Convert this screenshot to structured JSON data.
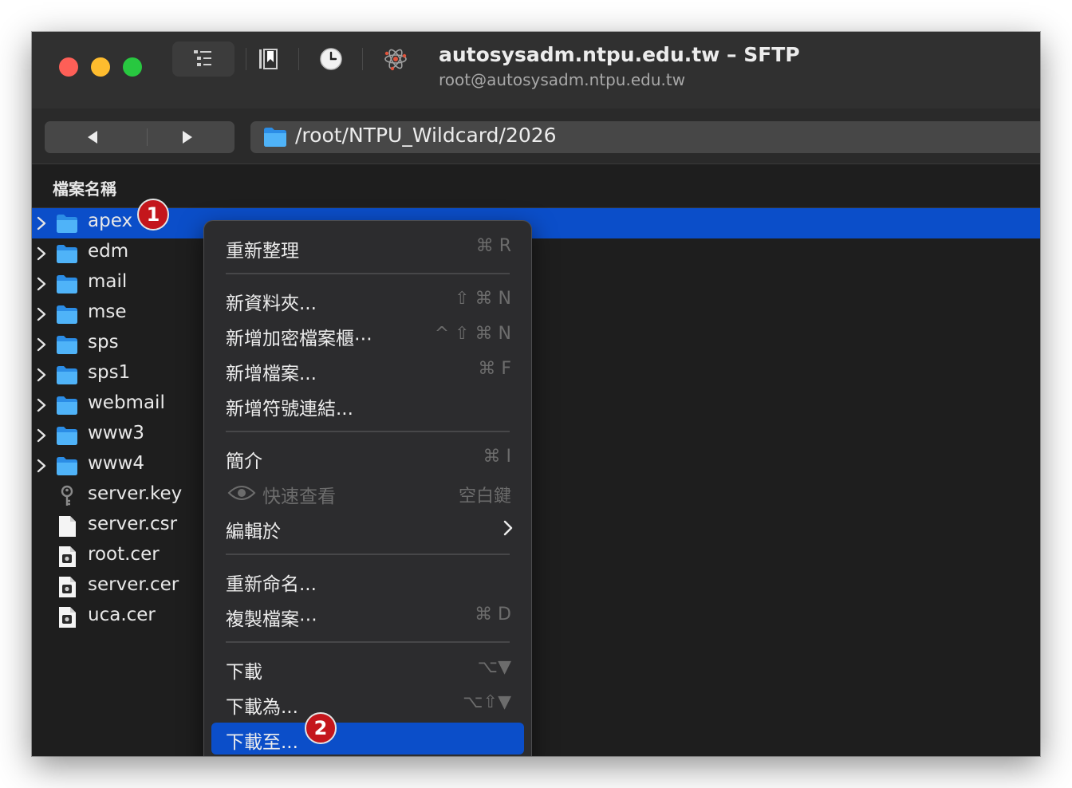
{
  "window": {
    "title": "autosysadm.ntpu.edu.tw – SFTP",
    "subtitle": "root@autosysadm.ntpu.edu.tw"
  },
  "toolbar": {
    "icons": [
      "outline-view-icon",
      "bookmarks-icon",
      "history-icon",
      "connection-icon"
    ]
  },
  "path": {
    "value": "/root/NTPU_Wildcard/2026"
  },
  "list": {
    "column_name": "檔案名稱",
    "items": [
      {
        "name": "apex",
        "type": "folder",
        "selected": true
      },
      {
        "name": "edm",
        "type": "folder"
      },
      {
        "name": "mail",
        "type": "folder"
      },
      {
        "name": "mse",
        "type": "folder"
      },
      {
        "name": "sps",
        "type": "folder"
      },
      {
        "name": "sps1",
        "type": "folder"
      },
      {
        "name": "webmail",
        "type": "folder"
      },
      {
        "name": "www3",
        "type": "folder"
      },
      {
        "name": "www4",
        "type": "folder"
      },
      {
        "name": "server.key",
        "type": "key"
      },
      {
        "name": "server.csr",
        "type": "document"
      },
      {
        "name": "root.cer",
        "type": "certificate"
      },
      {
        "name": "server.cer",
        "type": "certificate"
      },
      {
        "name": "uca.cer",
        "type": "certificate"
      }
    ]
  },
  "context_menu": {
    "items": [
      {
        "label": "重新整理",
        "shortcut": "⌘ R"
      },
      {
        "label": "新資料夾...",
        "shortcut": "⇧ ⌘ N"
      },
      {
        "label": "新增加密檔案櫃⋯",
        "shortcut": "^ ⇧ ⌘ N"
      },
      {
        "label": "新增檔案...",
        "shortcut": "⌘ F"
      },
      {
        "label": "新增符號連結..."
      },
      {
        "label": "簡介",
        "shortcut": "⌘ I"
      },
      {
        "label": "快速查看",
        "shortcut": "空白鍵",
        "disabled": true
      },
      {
        "label": "編輯於",
        "submenu": true
      },
      {
        "label": "重新命名..."
      },
      {
        "label": "複製檔案⋯",
        "shortcut": "⌘ D"
      },
      {
        "label": "下載",
        "shortcut": "⌥▼"
      },
      {
        "label": "下載為...",
        "shortcut": "⌥⇧▼"
      },
      {
        "label": "下載至...",
        "highlighted": true
      }
    ]
  },
  "annotations": {
    "step1": "1",
    "step2": "2"
  },
  "colors": {
    "selection": "#0b4ec9",
    "folder": "#3aa3f4",
    "badge": "#c4161c",
    "close": "#fe5f57",
    "minimize": "#febc2e",
    "maximize": "#28c840"
  }
}
